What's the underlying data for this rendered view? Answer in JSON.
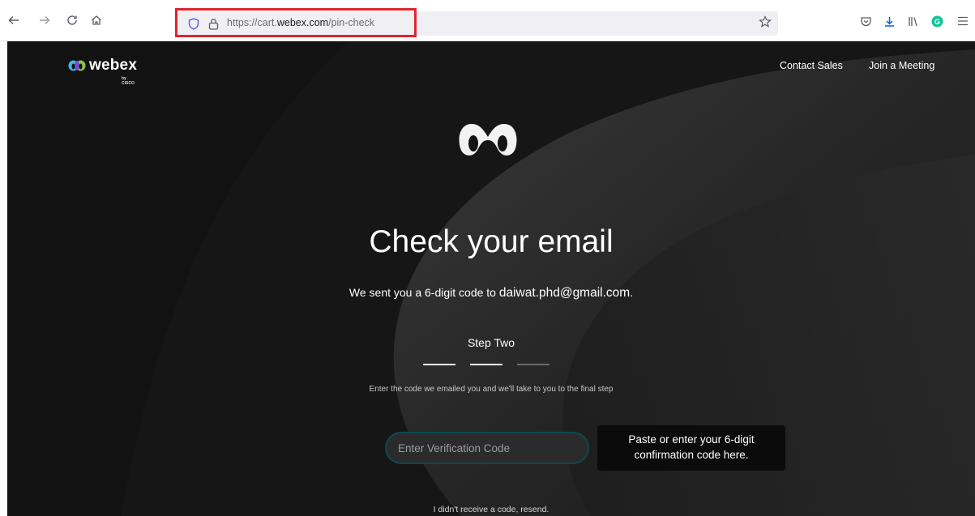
{
  "browser": {
    "url_prefix": "https://cart.",
    "url_domain": "webex.com",
    "url_path": "/pin-check",
    "icons": {
      "back": "arrow-left-icon",
      "forward": "arrow-right-icon",
      "reload": "reload-icon",
      "home": "home-icon",
      "shield": "shield-icon",
      "lock": "lock-icon",
      "bookmark": "star-icon",
      "pocket": "pocket-icon",
      "downloads": "download-icon",
      "library": "library-icon",
      "extension": "grammarly-icon",
      "menu": "hamburger-menu-icon"
    },
    "colors": {
      "highlight": "#e0242d",
      "download_accent": "#0060df",
      "extension": "#15c39a"
    }
  },
  "site": {
    "logo_text": "webex",
    "logo_sub": "by CISCO",
    "nav": {
      "contact_sales": "Contact Sales",
      "join_meeting": "Join a Meeting"
    }
  },
  "main": {
    "title": "Check your email",
    "sent_prefix": "We sent you a 6-digit code to ",
    "email": "daiwat.phd@gmail.com",
    "sent_suffix": ".",
    "step_label": "Step Two",
    "steps": {
      "total": 3,
      "completed": 2
    },
    "instructions": "Enter the code we emailed you and we'll take to you to the final step",
    "code_input": {
      "placeholder": "Enter Verification Code",
      "value": ""
    },
    "tooltip_line1": "Paste or enter your 6-digit",
    "tooltip_line2": "confirmation code here.",
    "resend": "I didn't receive a code, resend."
  }
}
